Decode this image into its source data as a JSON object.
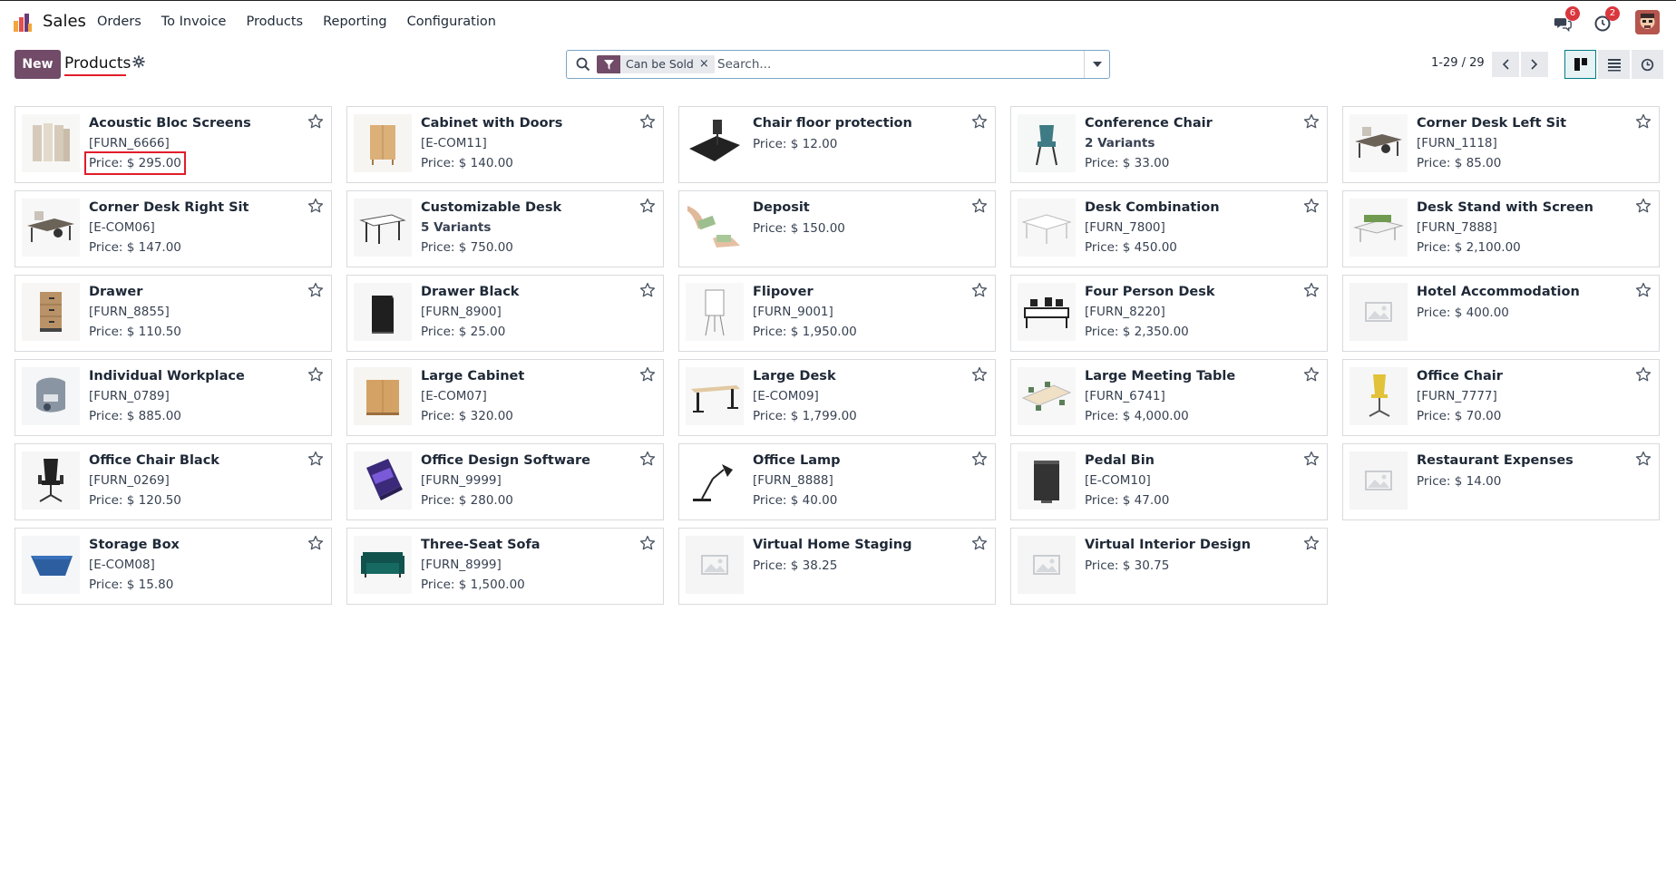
{
  "app": {
    "name": "Sales"
  },
  "menu": [
    "Orders",
    "To Invoice",
    "Products",
    "Reporting",
    "Configuration"
  ],
  "systray": {
    "messages_badge": "6",
    "activity_badge": "2",
    "icons": [
      "chat-icon",
      "clock-icon",
      "user-avatar"
    ]
  },
  "control": {
    "new_label": "New",
    "breadcrumb_title": "Products",
    "gear_icon": "gear-icon"
  },
  "search": {
    "facet_label": "Can be Sold",
    "facet_remove": "×",
    "placeholder": "Search..."
  },
  "pager": {
    "text": "1-29 / 29"
  },
  "views": [
    "kanban-view",
    "list-view",
    "activity-view"
  ],
  "colors": {
    "brand": "#714b67",
    "accent": "#017e84",
    "highlight": "#e11d2a",
    "badge": "#d9363e"
  },
  "products": [
    {
      "name": "Acoustic Bloc Screens",
      "ref": "[FURN_6666]",
      "price": "Price: $ 295.00",
      "image": "acoustic-screens",
      "highlight": true
    },
    {
      "name": "Cabinet with Doors",
      "ref": "[E-COM11]",
      "price": "Price: $ 140.00",
      "image": "wood-cabinet"
    },
    {
      "name": "Chair floor protection",
      "ref": "",
      "price": "Price: $ 12.00",
      "image": "floor-mat"
    },
    {
      "name": "Conference Chair",
      "ref": "2 Variants",
      "ref_bold": true,
      "price": "Price: $ 33.00",
      "image": "teal-chair"
    },
    {
      "name": "Corner Desk Left Sit",
      "ref": "[FURN_1118]",
      "price": "Price: $ 85.00",
      "image": "corner-desk"
    },
    {
      "name": "Corner Desk Right Sit",
      "ref": "[E-COM06]",
      "price": "Price: $ 147.00",
      "image": "corner-desk"
    },
    {
      "name": "Customizable Desk",
      "ref": "5 Variants",
      "ref_bold": true,
      "price": "Price: $ 750.00",
      "image": "white-desk"
    },
    {
      "name": "Deposit",
      "ref": "",
      "price": "Price: $ 150.00",
      "image": "money-hands"
    },
    {
      "name": "Desk Combination",
      "ref": "[FURN_7800]",
      "price": "Price: $ 450.00",
      "image": "white-desk-combo"
    },
    {
      "name": "Desk Stand with Screen",
      "ref": "[FURN_7888]",
      "price": "Price: $ 2,100.00",
      "image": "green-desk-screen"
    },
    {
      "name": "Drawer",
      "ref": "[FURN_8855]",
      "price": "Price: $ 110.50",
      "image": "wood-drawer"
    },
    {
      "name": "Drawer Black",
      "ref": "[FURN_8900]",
      "price": "Price: $ 25.00",
      "image": "black-drawer"
    },
    {
      "name": "Flipover",
      "ref": "[FURN_9001]",
      "price": "Price: $ 1,950.00",
      "image": "flipchart"
    },
    {
      "name": "Four Person Desk",
      "ref": "[FURN_8220]",
      "price": "Price: $ 2,350.00",
      "image": "four-desk"
    },
    {
      "name": "Hotel Accommodation",
      "ref": "",
      "price": "Price: $ 400.00",
      "image": "placeholder"
    },
    {
      "name": "Individual Workplace",
      "ref": "[FURN_0789]",
      "price": "Price: $ 885.00",
      "image": "workplace-pod"
    },
    {
      "name": "Large Cabinet",
      "ref": "[E-COM07]",
      "price": "Price: $ 320.00",
      "image": "large-cabinet"
    },
    {
      "name": "Large Desk",
      "ref": "[E-COM09]",
      "price": "Price: $ 1,799.00",
      "image": "large-desk"
    },
    {
      "name": "Large Meeting Table",
      "ref": "[FURN_6741]",
      "price": "Price: $ 4,000.00",
      "image": "meeting-table"
    },
    {
      "name": "Office Chair",
      "ref": "[FURN_7777]",
      "price": "Price: $ 70.00",
      "image": "yellow-chair"
    },
    {
      "name": "Office Chair Black",
      "ref": "[FURN_0269]",
      "price": "Price: $ 120.50",
      "image": "black-chair"
    },
    {
      "name": "Office Design Software",
      "ref": "[FURN_9999]",
      "price": "Price: $ 280.00",
      "image": "software-box"
    },
    {
      "name": "Office Lamp",
      "ref": "[FURN_8888]",
      "price": "Price: $ 40.00",
      "image": "desk-lamp"
    },
    {
      "name": "Pedal Bin",
      "ref": "[E-COM10]",
      "price": "Price: $ 47.00",
      "image": "pedal-bin"
    },
    {
      "name": "Restaurant Expenses",
      "ref": "",
      "price": "Price: $ 14.00",
      "image": "placeholder"
    },
    {
      "name": "Storage Box",
      "ref": "[E-COM08]",
      "price": "Price: $ 15.80",
      "image": "blue-box"
    },
    {
      "name": "Three-Seat Sofa",
      "ref": "[FURN_8999]",
      "price": "Price: $ 1,500.00",
      "image": "green-sofa"
    },
    {
      "name": "Virtual Home Staging",
      "ref": "",
      "price": "Price: $ 38.25",
      "image": "placeholder"
    },
    {
      "name": "Virtual Interior Design",
      "ref": "",
      "price": "Price: $ 30.75",
      "image": "placeholder"
    }
  ]
}
